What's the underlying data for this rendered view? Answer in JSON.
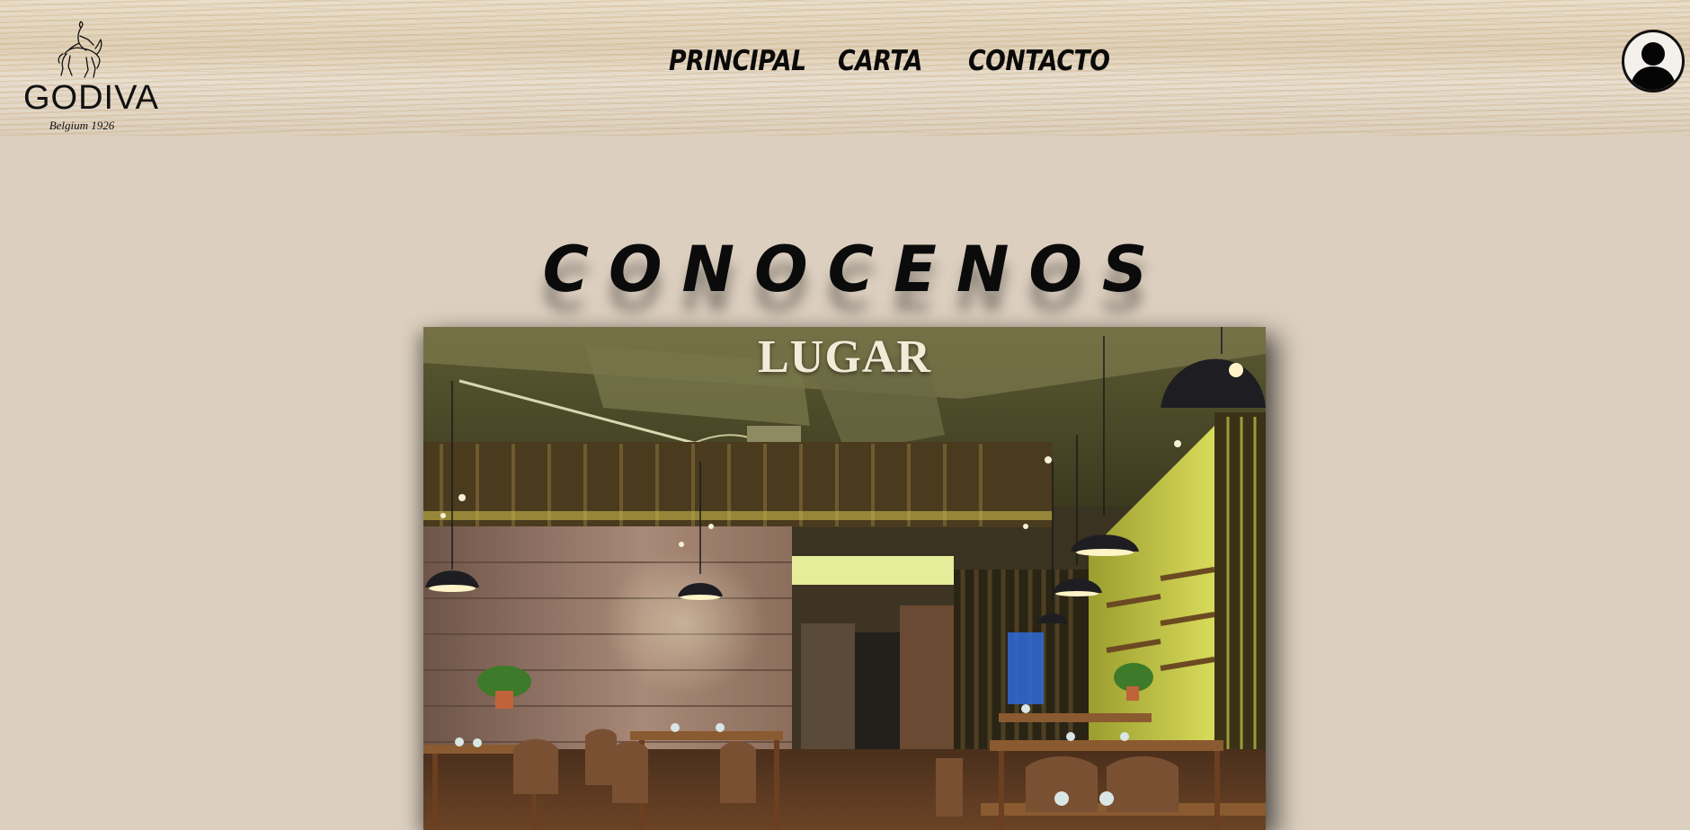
{
  "brand": {
    "name": "GODIVA",
    "tagline": "Belgium 1926"
  },
  "nav": {
    "items": [
      {
        "label": "PRINCIPAL"
      },
      {
        "label": "CARTA"
      },
      {
        "label": "CONTACTO"
      }
    ]
  },
  "user": {
    "icon": "user-avatar-icon"
  },
  "main": {
    "title": "CONOCENOS",
    "card": {
      "title": "LUGAR",
      "image": "restaurant-interior-photo"
    }
  },
  "colors": {
    "page_background": "#dccfbf",
    "text": "#0b0b0b",
    "card_title": "#f3ead8"
  }
}
